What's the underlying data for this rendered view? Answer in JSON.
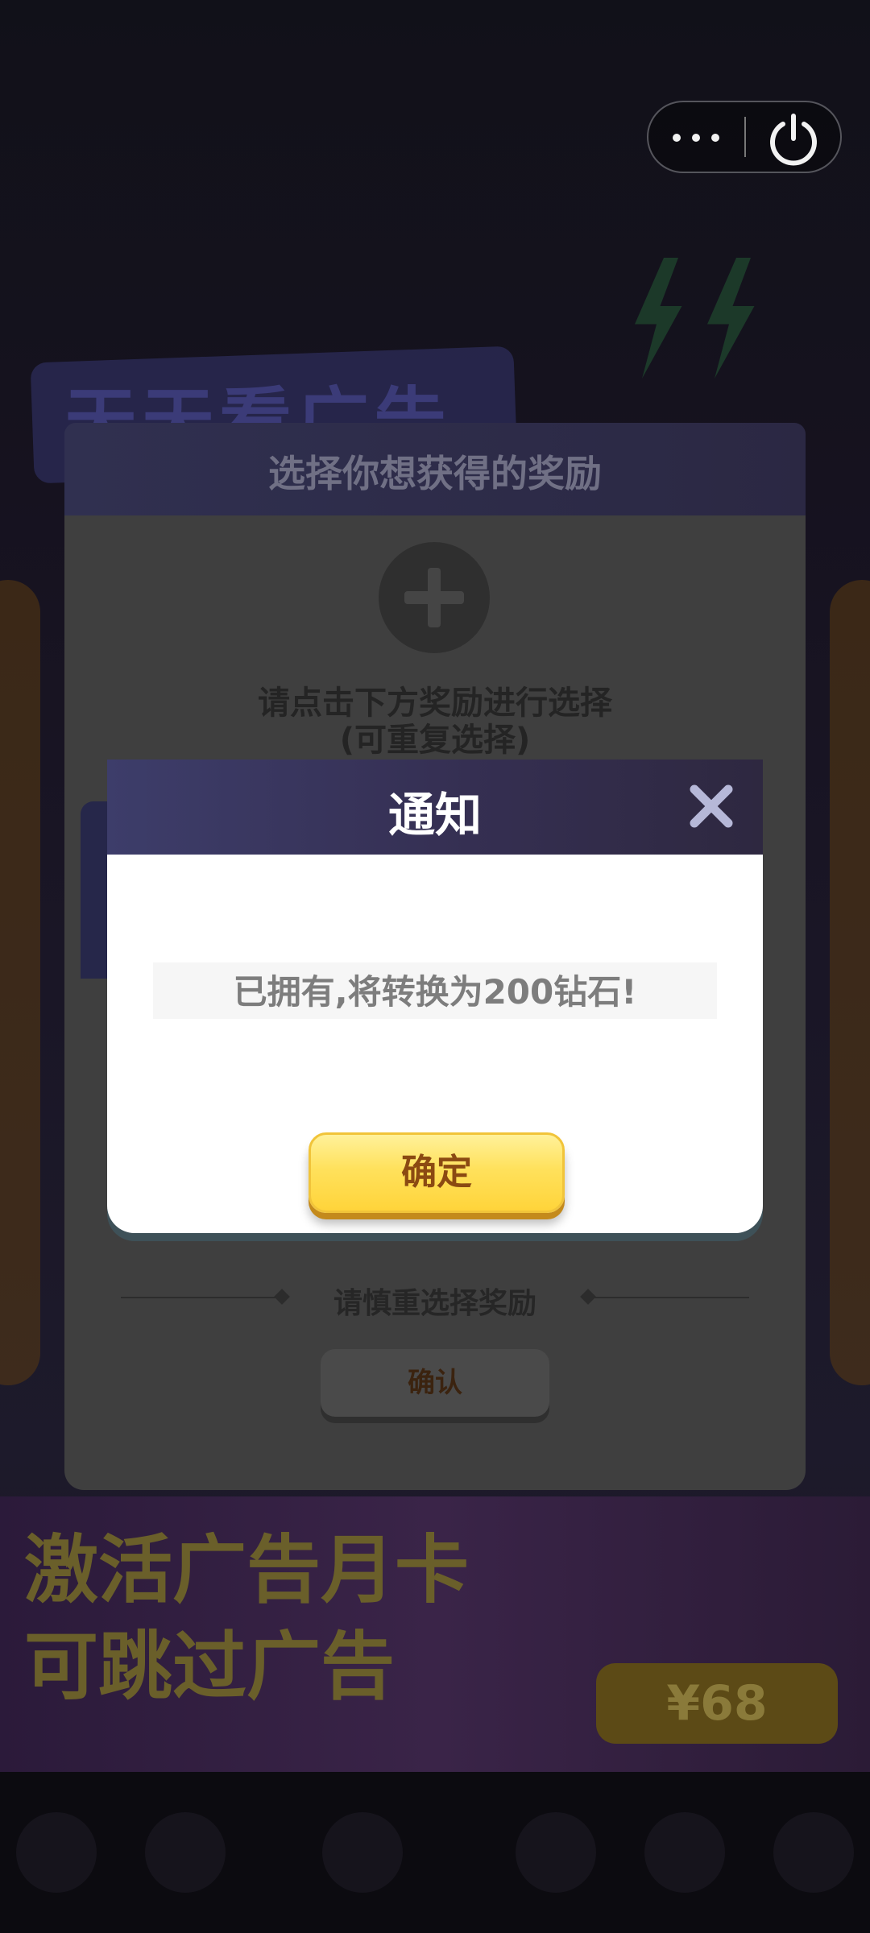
{
  "background": {
    "banner_title": "天天看广告",
    "bottom_banner_text": "激活广告月卡\n可跳过广告",
    "bottom_banner_price": "¥68"
  },
  "panel": {
    "title": "选择你想获得的奖励",
    "hint_line1": "请点击下方奖励进行选择",
    "hint_line2": "(可重复选择)",
    "caution": "请慎重选择奖励",
    "confirm_label": "确认"
  },
  "dialog": {
    "title": "通知",
    "message": "已拥有,将转换为200钻石!",
    "ok_label": "确定"
  },
  "icons": {
    "more": "more-dots-icon",
    "power": "power-icon",
    "close": "close-icon",
    "add": "plus-icon"
  },
  "colors": {
    "dialog_header": "#3d3d6a",
    "ok_button": "#ffe15c",
    "ok_text": "#8b4a12",
    "close_icon": "#b6b8d8"
  }
}
